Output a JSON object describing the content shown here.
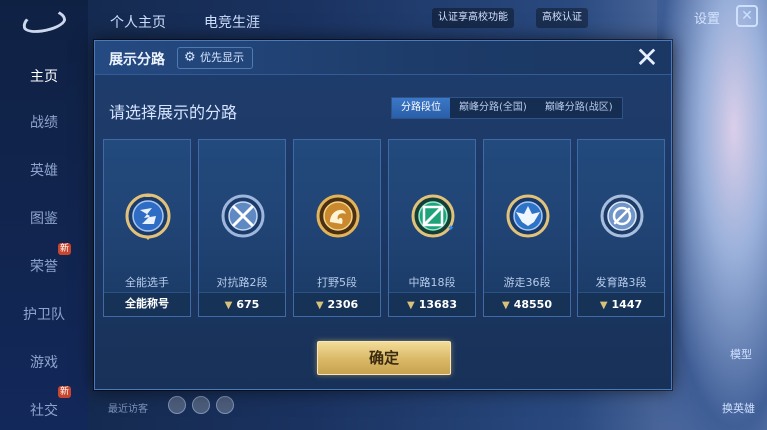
{
  "background": {
    "sidebar": [
      {
        "label": "主页",
        "active": true
      },
      {
        "label": "战绩",
        "active": false
      },
      {
        "label": "英雄",
        "active": false
      },
      {
        "label": "图鉴",
        "active": false
      },
      {
        "label": "荣誉",
        "active": false
      },
      {
        "label": "护卫队",
        "active": false
      },
      {
        "label": "游戏",
        "active": false
      },
      {
        "label": "社交",
        "active": false
      }
    ],
    "badge": "新",
    "top_tabs": [
      "个人主页",
      "电竞生涯"
    ],
    "verify_text": "认证享高校功能",
    "campus_text": "高校认证",
    "settings": "设置",
    "recent_visitors": "最近访客",
    "bottom_right": [
      "模型",
      "换英雄"
    ]
  },
  "modal": {
    "title": "展示分路",
    "priority_label": "优先显示",
    "close": "✕",
    "prompt": "请选择展示的分路",
    "tabs": [
      {
        "label": "分路段位",
        "active": true
      },
      {
        "label": "巅峰分路(全国)",
        "active": false
      },
      {
        "label": "巅峰分路(战区)",
        "active": false
      }
    ],
    "cards": [
      {
        "name": "全能选手",
        "score": "全能称号",
        "icon": "all-round-emblem-icon",
        "accent": "#3f7fd8"
      },
      {
        "name": "对抗路2段",
        "score": "675",
        "icon": "clash-lane-emblem-icon",
        "accent": "#7fa6d8"
      },
      {
        "name": "打野5段",
        "score": "2306",
        "icon": "jungle-emblem-icon",
        "accent": "#d19a3a"
      },
      {
        "name": "中路18段",
        "score": "13683",
        "icon": "mid-lane-emblem-icon",
        "accent": "#2fb389"
      },
      {
        "name": "游走36段",
        "score": "48550",
        "icon": "roam-emblem-icon",
        "accent": "#3f86d8"
      },
      {
        "name": "发育路3段",
        "score": "1447",
        "icon": "farm-lane-emblem-icon",
        "accent": "#9bb7de"
      }
    ],
    "confirm": "确定"
  }
}
